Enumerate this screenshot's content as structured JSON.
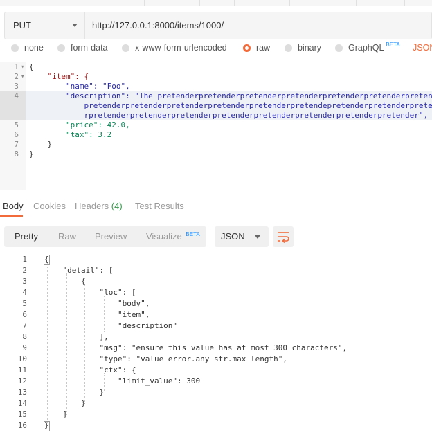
{
  "request": {
    "method": "PUT",
    "url": "http://127.0.0.1:8000/items/1000/"
  },
  "body_types": [
    {
      "label": "none",
      "selected": false
    },
    {
      "label": "form-data",
      "selected": false
    },
    {
      "label": "x-www-form-urlencoded",
      "selected": false
    },
    {
      "label": "raw",
      "selected": true
    },
    {
      "label": "binary",
      "selected": false
    },
    {
      "label": "GraphQL",
      "selected": false,
      "badge": "BETA"
    }
  ],
  "raw_format": "JSON",
  "request_editor": {
    "line_numbers": [
      "1",
      "2",
      "3",
      "4",
      "5",
      "6",
      "7",
      "8"
    ],
    "lines": [
      "{",
      "    \"item\": {",
      "        \"name\": \"Foo\",",
      "        \"description\": \"The pretenderpretenderpretenderpretenderpretenderpretenderpretende",
      "            pretenderpretenderpretenderpretenderpretenderpretendepretenderpretenderpretender",
      "            rpretenderpretenderpretenderpretenderpretenderpretenderpretenderpretender\",",
      "        \"price\": 42.0,",
      "        \"tax\": 3.2",
      "    }",
      "}"
    ]
  },
  "response_tabs": [
    {
      "label": "Body",
      "active": true
    },
    {
      "label": "Cookies",
      "active": false
    },
    {
      "label": "Headers",
      "count": "(4)",
      "active": false
    },
    {
      "label": "Test Results",
      "active": false
    }
  ],
  "view_modes": [
    {
      "label": "Pretty",
      "active": true
    },
    {
      "label": "Raw",
      "active": false
    },
    {
      "label": "Preview",
      "active": false
    },
    {
      "label": "Visualize",
      "active": false,
      "badge": "BETA"
    }
  ],
  "response_format": "JSON",
  "response_body": {
    "line_numbers": [
      "1",
      "2",
      "3",
      "4",
      "5",
      "6",
      "7",
      "8",
      "9",
      "10",
      "11",
      "12",
      "13",
      "14",
      "15",
      "16"
    ],
    "lines": [
      "{",
      "    \"detail\": [",
      "        {",
      "            \"loc\": [",
      "                \"body\",",
      "                \"item\",",
      "                \"description\"",
      "            ],",
      "            \"msg\": \"ensure this value has at most 300 characters\",",
      "            \"type\": \"value_error.any_str.max_length\",",
      "            \"ctx\": {",
      "                \"limit_value\": 300",
      "            }",
      "        }",
      "    ]",
      "}"
    ]
  },
  "colors": {
    "accent": "#f26b3a",
    "key": "#a31515",
    "string": "#2a2aa8",
    "number": "#098658",
    "beta": "#1e90ff",
    "count": "#3a9b4e"
  }
}
